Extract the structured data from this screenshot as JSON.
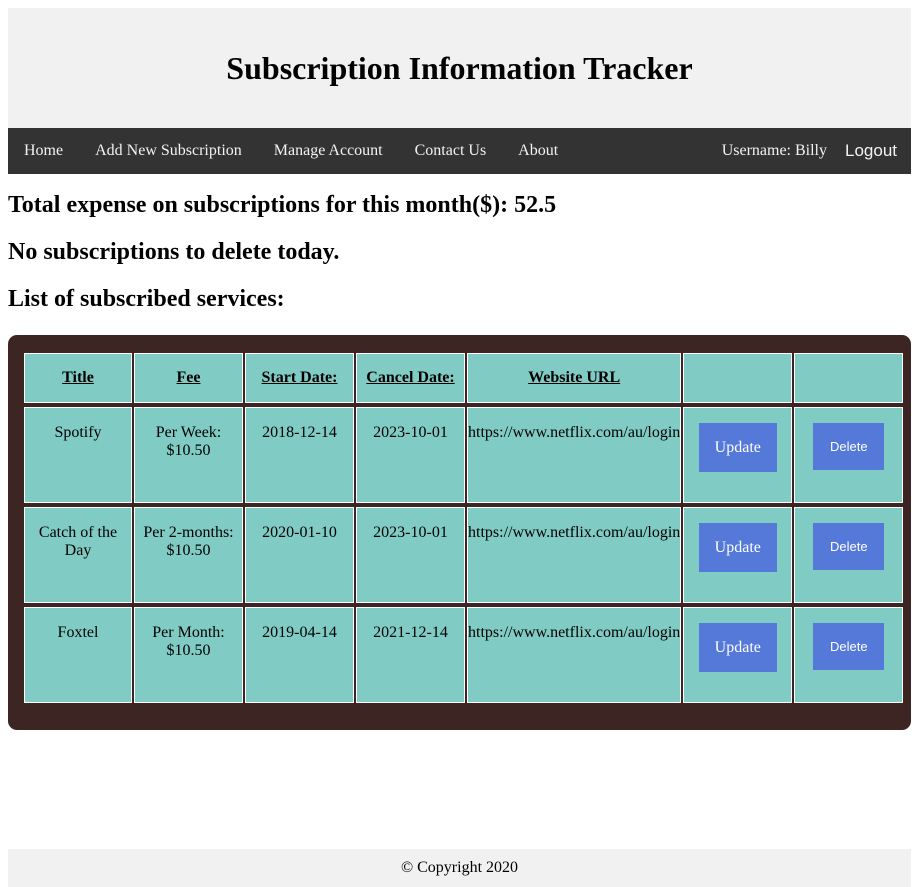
{
  "header": {
    "title": "Subscription Information Tracker"
  },
  "nav": {
    "links": [
      "Home",
      "Add New Subscription",
      "Manage Account",
      "Contact Us",
      "About"
    ],
    "username": "Username: Billy",
    "logout": "Logout"
  },
  "summary": {
    "total_expense": "Total expense on subscriptions for this month($): 52.5",
    "delete_notice": "No subscriptions to delete today.",
    "list_heading": "List of subscribed services:"
  },
  "table": {
    "headers": [
      "Title",
      "Fee",
      "Start Date:",
      "Cancel Date:",
      "Website URL",
      "",
      ""
    ],
    "rows": [
      {
        "title": "Spotify",
        "fee_period": "Per Week:",
        "fee_amount": "$10.50",
        "start_date": "2018-12-14",
        "cancel_date": "2023-10-01",
        "url": "https://www.netflix.com/au/login",
        "update_label": "Update",
        "delete_label": "Delete"
      },
      {
        "title": "Catch of the Day",
        "fee_period": "Per 2-months:",
        "fee_amount": "$10.50",
        "start_date": "2020-01-10",
        "cancel_date": "2023-10-01",
        "url": "https://www.netflix.com/au/login",
        "update_label": "Update",
        "delete_label": "Delete"
      },
      {
        "title": "Foxtel",
        "fee_period": "Per Month:",
        "fee_amount": "$10.50",
        "start_date": "2019-04-14",
        "cancel_date": "2021-12-14",
        "url": "https://www.netflix.com/au/login",
        "update_label": "Update",
        "delete_label": "Delete"
      }
    ]
  },
  "footer": {
    "copyright": "© Copyright 2020"
  },
  "colors": {
    "header_bg": "#f1f1f1",
    "nav_bg": "#333333",
    "table_container_bg": "#3c2522",
    "cell_bg": "#80cbc4",
    "button_bg": "#5479d9"
  }
}
